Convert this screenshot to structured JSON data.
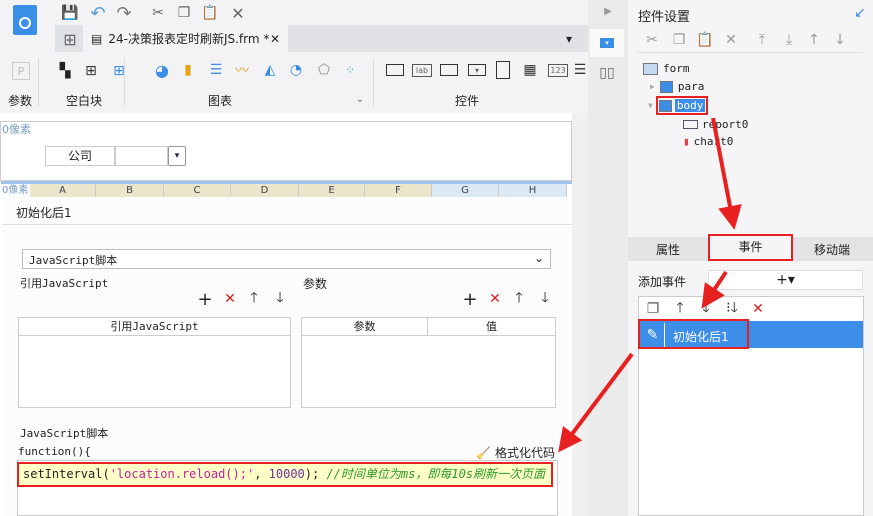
{
  "toolbar": {
    "tab_title": "24-决策报表定时刷新JS.frm *",
    "groups": {
      "param": "参数",
      "blank": "空白块",
      "chart": "图表",
      "widget": "控件"
    }
  },
  "canvas": {
    "para_pixel": "0像素",
    "body_pixel": "0像素",
    "company_label": "公司",
    "columns": [
      "A",
      "B",
      "C",
      "D",
      "E",
      "F",
      "G",
      "H"
    ]
  },
  "event_editor": {
    "title": "初始化后1",
    "type_select": "JavaScript脚本",
    "ref_js_label": "引用JavaScript",
    "params_label": "参数",
    "ref_js_header": "引用JavaScript",
    "param_header": "参数",
    "value_header": "值",
    "script_label": "JavaScript脚本",
    "function_header": "function(){",
    "format_code": "格式化代码",
    "code": {
      "fn": "setInterval(",
      "str": "'location.reload();'",
      "sep": ", ",
      "num": "10000",
      "end": ");",
      "comment": " //时间单位为ms，即每10s刷新一次页面"
    }
  },
  "right_panel": {
    "title": "控件设置",
    "tree": {
      "form": "form",
      "para": "para",
      "body": "body",
      "report": "report0",
      "chart": "chart0"
    },
    "tabs": {
      "attr": "属性",
      "event": "事件",
      "mobile": "移动端"
    },
    "add_event_label": "添加事件",
    "add_event_btn": "+▾",
    "event_item": "初始化后1"
  },
  "colors": {
    "accent": "#3d8ee8",
    "highlight": "#e82020",
    "code_bg": "#ffffc8"
  }
}
